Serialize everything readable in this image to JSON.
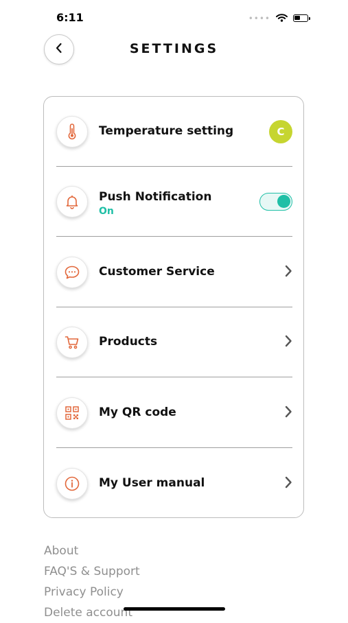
{
  "status_bar": {
    "time": "6:11"
  },
  "header": {
    "title": "SETTINGS"
  },
  "settings": {
    "temperature": {
      "label": "Temperature setting",
      "unit_badge": "C"
    },
    "push": {
      "label": "Push Notification",
      "status": "On",
      "enabled": true
    },
    "customer_service": {
      "label": "Customer Service"
    },
    "products": {
      "label": "Products"
    },
    "qr": {
      "label": "My QR code"
    },
    "manual": {
      "label": "My User manual"
    }
  },
  "footer": {
    "about": "About",
    "faq": "FAQ'S & Support",
    "privacy": "Privacy Policy",
    "delete": "Delete account"
  },
  "colors": {
    "accent_orange": "#e2673a",
    "accent_teal": "#1fbfa6",
    "badge_green": "#c6d530"
  },
  "icons": [
    "back-icon",
    "thermometer-icon",
    "bell-icon",
    "chat-bubble-icon",
    "cart-icon",
    "qr-code-icon",
    "info-icon",
    "chevron-right-icon",
    "wifi-icon",
    "battery-icon"
  ]
}
